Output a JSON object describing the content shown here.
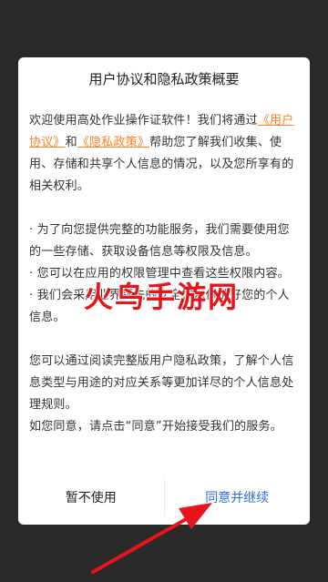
{
  "dialog": {
    "title": "用户协议和隐私政策概要",
    "intro_prefix": "欢迎使用高处作业操作证软件！我们将通过",
    "user_agreement_link": "《用户协议》",
    "intro_and": "和",
    "privacy_policy_link": "《隐私政策》",
    "intro_suffix": "帮助您了解我们收集、使用、存储和共享个人信息的情况，以及您所享有的相关权利。",
    "bullets": [
      "· 为了向您提供完整的功能服务，我们需要使用您的一些存储、获取设备信息等权限及信息。",
      "· 您可以在应用的权限管理中查看这些权限内容。",
      "· 我们会采用业界领先的安全技术保护好您的个人信息。"
    ],
    "outro": "您可以通过阅读完整版用户隐私政策，了解个人信息类型与用途的对应关系等更加详尽的个人信息处理规则。",
    "consent": "如您同意，请点击“同意”开始接受我们的服务。",
    "cancel_label": "暂不使用",
    "accept_label": "同意并继续"
  },
  "watermark": "火鸟手游网",
  "colors": {
    "link": "#ff7f24",
    "accept": "#2f6fdd",
    "watermark": "#e8141c",
    "arrow": "#e8141c"
  }
}
